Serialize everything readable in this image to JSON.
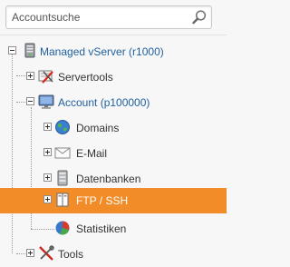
{
  "search": {
    "placeholder": "Accountsuche"
  },
  "tree": {
    "root": {
      "label": "Managed vServer (r1000)"
    },
    "servertools": {
      "label": "Servertools"
    },
    "account": {
      "label": "Account (p100000)"
    },
    "children": [
      {
        "label": "Domains"
      },
      {
        "label": "E-Mail"
      },
      {
        "label": "Datenbanken"
      },
      {
        "label": "FTP / SSH"
      },
      {
        "label": "Statistiken"
      }
    ],
    "tools": {
      "label": "Tools"
    }
  },
  "colors": {
    "selected": "#f28c28",
    "link": "#1f5f9e"
  }
}
